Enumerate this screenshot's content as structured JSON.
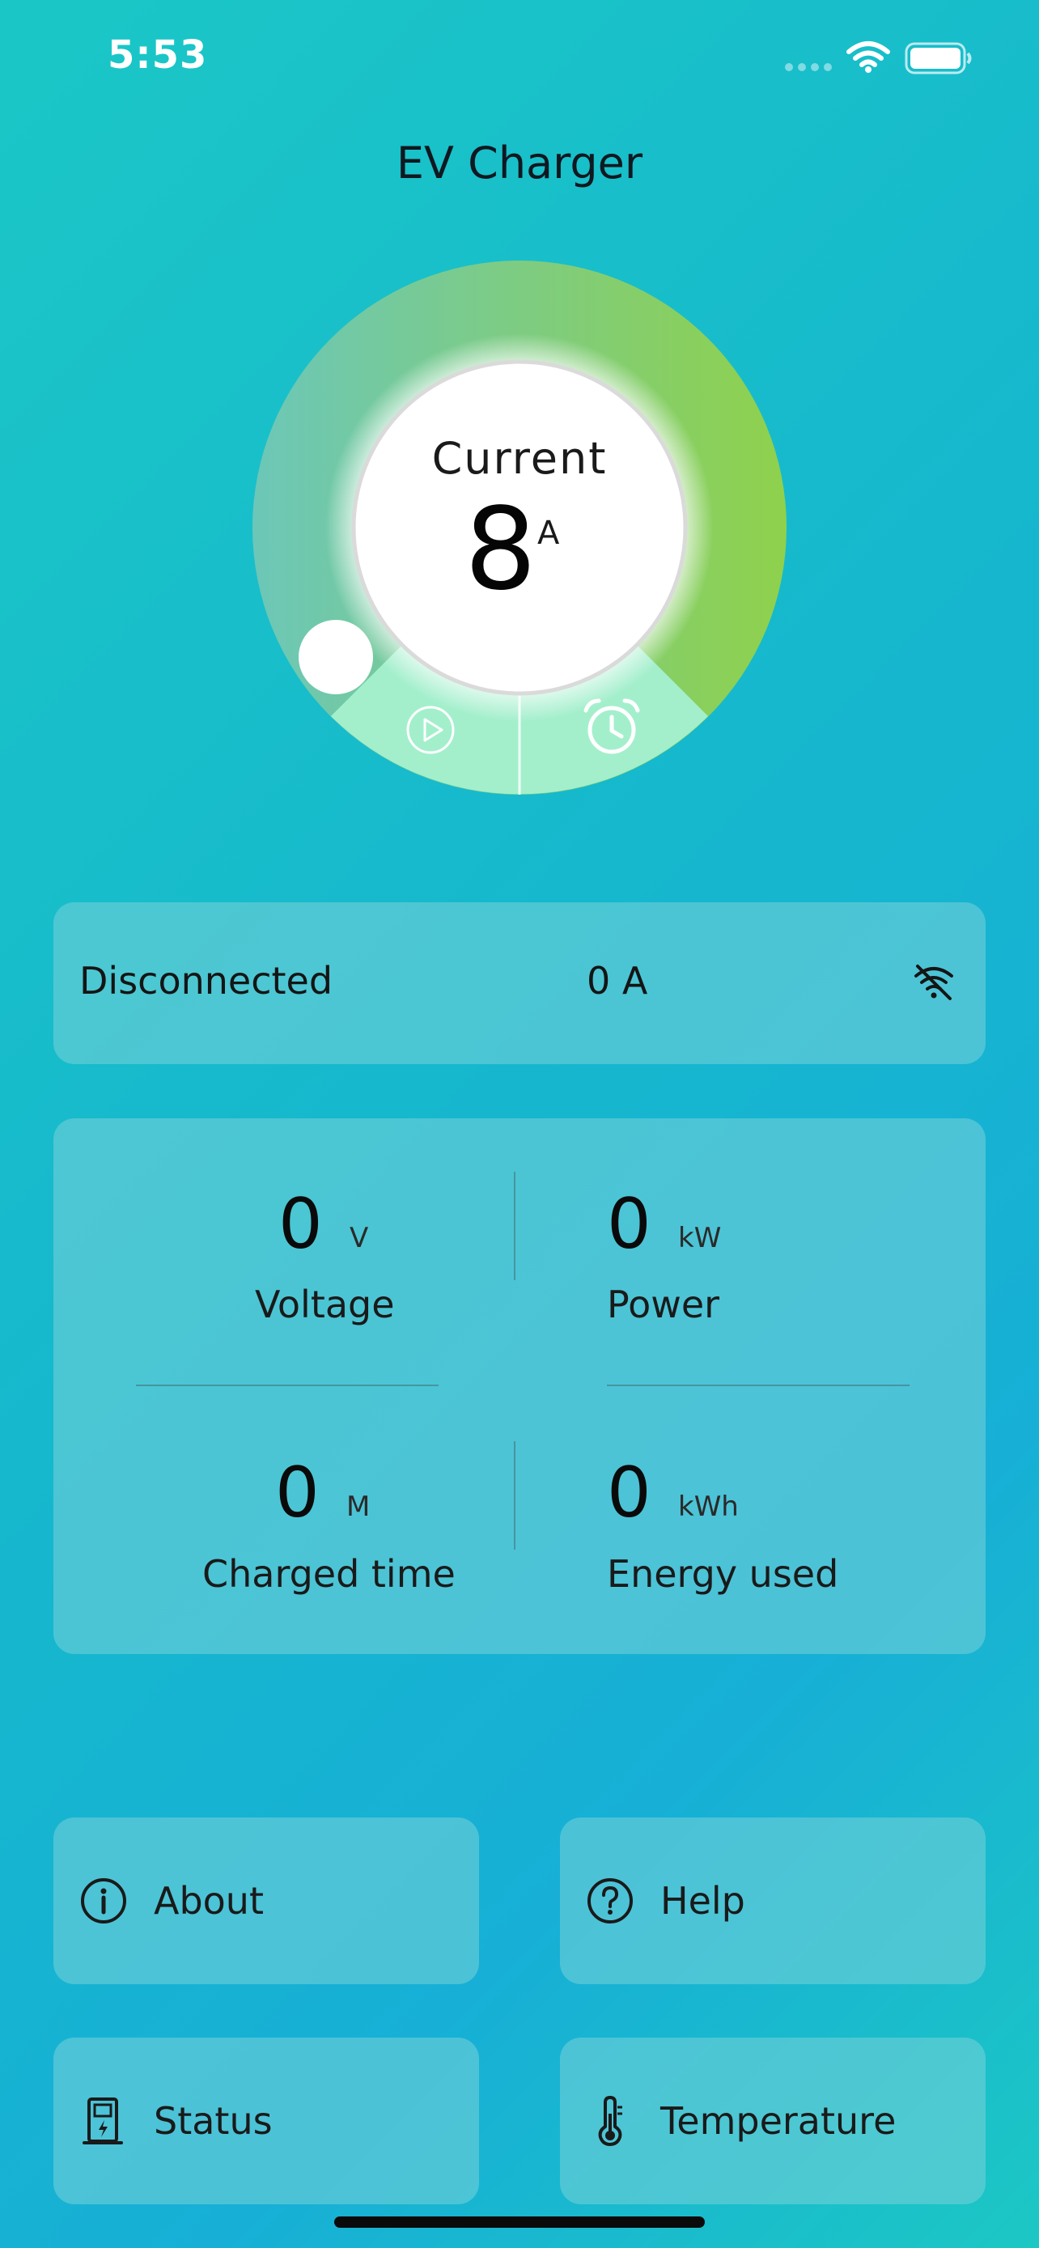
{
  "status_bar": {
    "time": "5:53"
  },
  "header": {
    "title": "EV Charger"
  },
  "gauge": {
    "label": "Current",
    "value": "8",
    "unit": "A",
    "level_fraction": 0.0,
    "colors": {
      "arc_start": "#6ec9b6",
      "arc_end": "#8fd14c",
      "bottom_segment": "#a3f0cc"
    },
    "left_action_icon": "play-icon",
    "right_action_icon": "alarm-clock-icon"
  },
  "connection": {
    "status": "Disconnected",
    "current": "0 A",
    "icon": "wifi-off-icon"
  },
  "metrics": {
    "voltage": {
      "value": "0",
      "unit": "V",
      "label": "Voltage"
    },
    "power": {
      "value": "0",
      "unit": "kW",
      "label": "Power"
    },
    "charged_time": {
      "value": "0",
      "unit": "M",
      "label": "Charged time"
    },
    "energy_used": {
      "value": "0",
      "unit": "kWh",
      "label": "Energy used"
    }
  },
  "menu": {
    "about": {
      "label": "About",
      "icon": "info-icon"
    },
    "help": {
      "label": "Help",
      "icon": "question-icon"
    },
    "status": {
      "label": "Status",
      "icon": "charging-station-icon"
    },
    "temperature": {
      "label": "Temperature",
      "icon": "thermometer-icon"
    }
  }
}
